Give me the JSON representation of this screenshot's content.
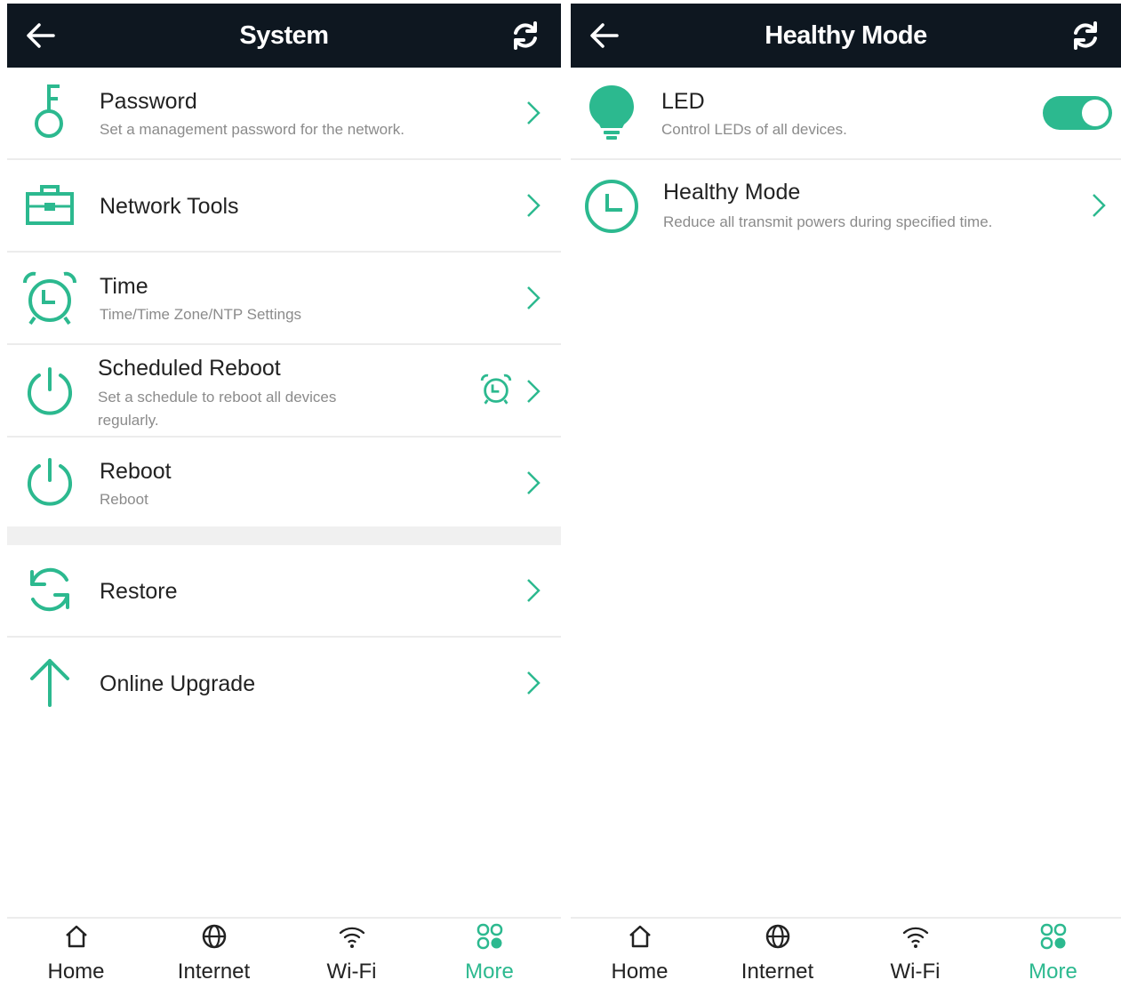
{
  "colors": {
    "accent": "#2cb98f",
    "header_bg": "#0e1720",
    "divider": "#ececec",
    "muted_text": "#8b8b8b"
  },
  "left_screen": {
    "title": "System",
    "items": [
      {
        "label": "Password",
        "desc": "Set a management password for the network.",
        "icon": "key-icon"
      },
      {
        "label": "Network Tools",
        "icon": "toolbox-icon"
      },
      {
        "label": "Time",
        "desc": "Time/Time Zone/NTP Settings",
        "icon": "alarm-clock-icon"
      },
      {
        "label": "Scheduled Reboot",
        "desc": "Set a schedule to reboot all devices regularly.",
        "icon": "power-icon",
        "badge_icon": "alarm-clock-icon"
      },
      {
        "label": "Reboot",
        "desc": "Reboot",
        "icon": "power-icon"
      },
      {
        "label": "Restore",
        "icon": "restore-icon"
      },
      {
        "label": "Online Upgrade",
        "icon": "arrow-up-icon"
      }
    ]
  },
  "right_screen": {
    "title": "Healthy Mode",
    "items": [
      {
        "label": "LED",
        "desc": "Control LEDs of all devices.",
        "icon": "bulb-icon",
        "toggle_on": true
      },
      {
        "label": "Healthy Mode",
        "desc": "Reduce all transmit powers during specified time.",
        "icon": "clock-icon"
      }
    ]
  },
  "tabbar": {
    "tabs": [
      {
        "label": "Home",
        "icon": "home-icon"
      },
      {
        "label": "Internet",
        "icon": "globe-icon"
      },
      {
        "label": "Wi-Fi",
        "icon": "wifi-icon"
      },
      {
        "label": "More",
        "icon": "more-icon",
        "active": true
      }
    ]
  }
}
